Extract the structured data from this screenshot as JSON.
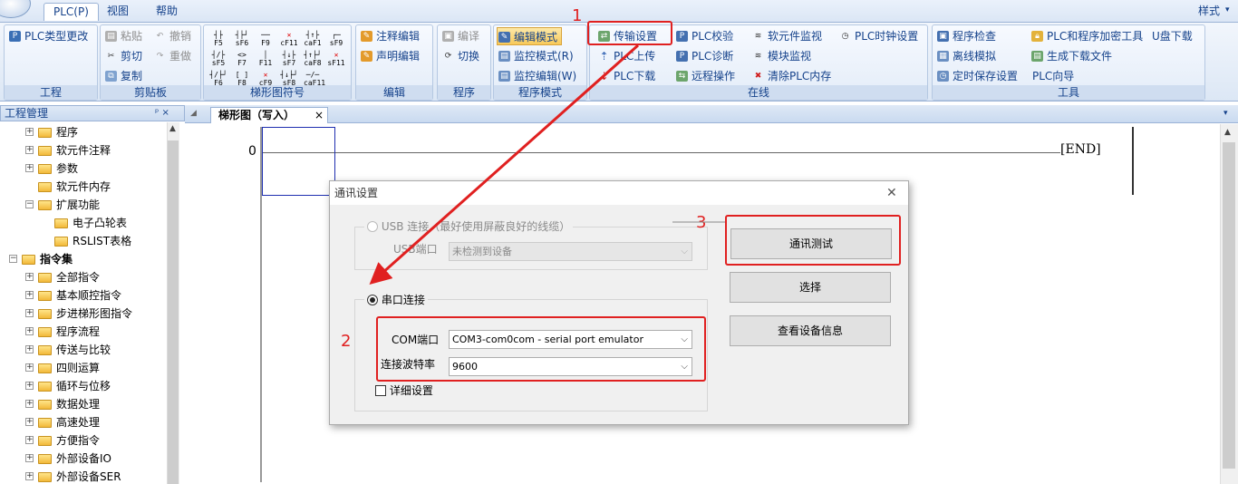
{
  "menubar": {
    "plc": "PLC(P)",
    "view": "视图",
    "help": "帮助",
    "style": "样式"
  },
  "ribbon": {
    "project": {
      "plc_type_change": "PLC类型更改",
      "label": "工程"
    },
    "clipboard": {
      "paste": "粘贴",
      "undo": "撤销",
      "cut": "剪切",
      "redo": "重做",
      "copy": "复制",
      "label": "剪贴板"
    },
    "ladder_symbols": {
      "row1": [
        "F5",
        "sF6",
        "F9",
        "cF11",
        "caF1",
        "sF9"
      ],
      "row2": [
        "sF5",
        "F7",
        "F11",
        "sF7",
        "caF8",
        "sF11"
      ],
      "row3": [
        "F6",
        "F8",
        "cF9",
        "sF8",
        "caF11"
      ],
      "label": "梯形图符号"
    },
    "edit": {
      "comment_edit": "注释编辑",
      "statement_edit": "声明编辑",
      "label": "编辑"
    },
    "program": {
      "compile": "编译",
      "switch": "切换",
      "label": "程序"
    },
    "program_mode": {
      "edit_mode": "编辑模式",
      "monitor_mode": "监控模式(R)",
      "monitor_edit": "监控编辑(W)",
      "label": "程序模式"
    },
    "online": {
      "transfer_settings": "传输设置",
      "plc_upload": "PLC上传",
      "plc_download": "PLC下载",
      "plc_verify": "PLC校验",
      "plc_diagnose": "PLC诊断",
      "remote_operation": "远程操作",
      "device_monitor": "软元件监视",
      "module_monitor": "模块监视",
      "clear_plc_memory": "清除PLC内存",
      "plc_clock": "PLC时钟设置",
      "label": "在线"
    },
    "tools": {
      "program_check": "程序检查",
      "offline_sim": "离线模拟",
      "timed_save": "定时保存设置",
      "encrypt_tool": "PLC和程序加密工具",
      "gen_download_file": "生成下载文件",
      "plc_wizard": "PLC向导",
      "usb_download": "U盘下载",
      "label": "工具"
    }
  },
  "project_panel": {
    "title": "工程管理",
    "pin": "ᵖ ×",
    "tree": [
      {
        "label": "程序",
        "indent": 1,
        "bold": false,
        "pm": "+"
      },
      {
        "label": "软元件注释",
        "indent": 1,
        "bold": false,
        "pm": "+"
      },
      {
        "label": "参数",
        "indent": 1,
        "bold": false,
        "pm": "+"
      },
      {
        "label": "软元件内存",
        "indent": 1,
        "bold": false,
        "pm": ""
      },
      {
        "label": "扩展功能",
        "indent": 1,
        "bold": false,
        "pm": "-"
      },
      {
        "label": "电子凸轮表",
        "indent": 2,
        "bold": false,
        "pm": ""
      },
      {
        "label": "RSLIST表格",
        "indent": 2,
        "bold": false,
        "pm": ""
      },
      {
        "label": "指令集",
        "indent": 0,
        "bold": true,
        "pm": "-"
      },
      {
        "label": "全部指令",
        "indent": 1,
        "bold": false,
        "pm": "+"
      },
      {
        "label": "基本顺控指令",
        "indent": 1,
        "bold": false,
        "pm": "+"
      },
      {
        "label": "步进梯形图指令",
        "indent": 1,
        "bold": false,
        "pm": "+"
      },
      {
        "label": "程序流程",
        "indent": 1,
        "bold": false,
        "pm": "+"
      },
      {
        "label": "传送与比较",
        "indent": 1,
        "bold": false,
        "pm": "+"
      },
      {
        "label": "四则运算",
        "indent": 1,
        "bold": false,
        "pm": "+"
      },
      {
        "label": "循环与位移",
        "indent": 1,
        "bold": false,
        "pm": "+"
      },
      {
        "label": "数据处理",
        "indent": 1,
        "bold": false,
        "pm": "+"
      },
      {
        "label": "高速处理",
        "indent": 1,
        "bold": false,
        "pm": "+"
      },
      {
        "label": "方便指令",
        "indent": 1,
        "bold": false,
        "pm": "+"
      },
      {
        "label": "外部设备IO",
        "indent": 1,
        "bold": false,
        "pm": "+"
      },
      {
        "label": "外部设备SER",
        "indent": 1,
        "bold": false,
        "pm": "+"
      }
    ]
  },
  "doc_tab": {
    "title": "梯形图（写入）",
    "close": "×"
  },
  "ladder": {
    "step": "0",
    "end": "END"
  },
  "dialog": {
    "title": "通讯设置",
    "usb_radio": "USB 连接（最好使用屏蔽良好的线缆）",
    "usb_port_label": "USB端口",
    "usb_port_value": "未检测到设备",
    "serial_radio": "串口连接",
    "com_label": "COM端口",
    "com_value": "COM3-com0com - serial port emulator",
    "baud_label": "连接波特率",
    "baud_value": "9600",
    "detail_checkbox": "详细设置",
    "btn_test": "通讯测试",
    "btn_select": "选择",
    "btn_device_info": "查看设备信息"
  },
  "annotations": {
    "n1": "1",
    "n2": "2",
    "n3": "3"
  },
  "colors": {
    "annotation_red": "#e02020",
    "ribbon_text": "#15428b"
  }
}
